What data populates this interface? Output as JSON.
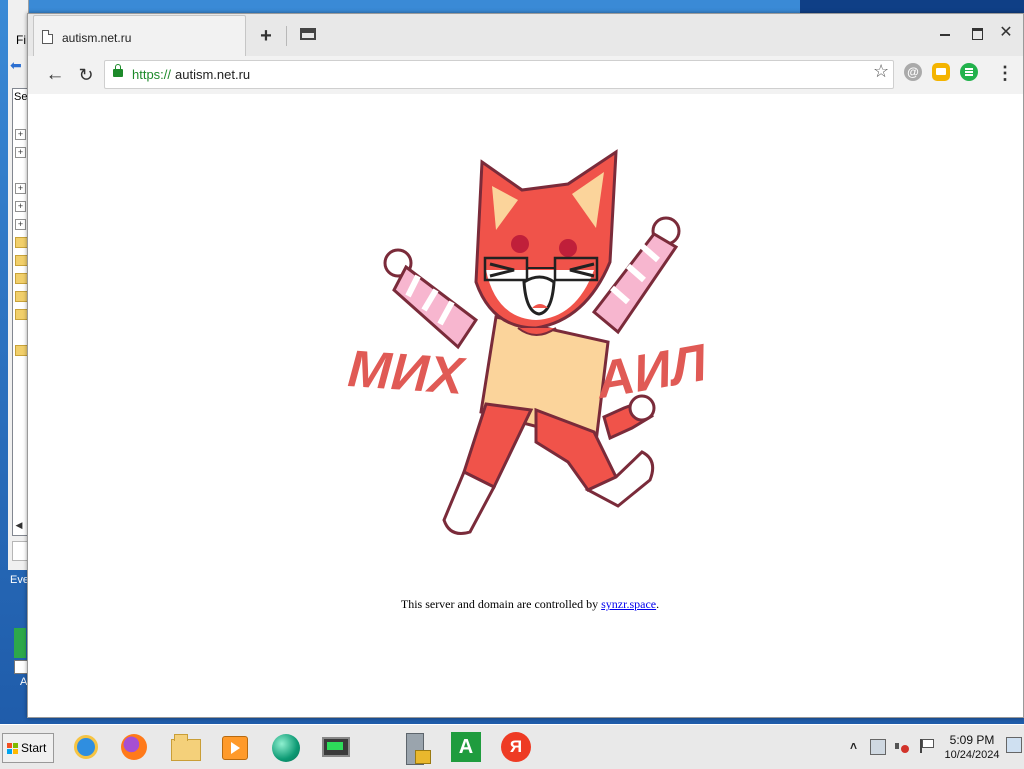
{
  "background_window": {
    "file_menu_label": "Fi",
    "tree_header": "Se",
    "desktop_label": "Eve",
    "desktop_icon_label": "A"
  },
  "browser": {
    "tab": {
      "title": "autism.net.ru"
    },
    "address_bar": {
      "protocol": "https://",
      "host": "autism.net.ru"
    },
    "extensions": [
      "mail-ru-extension",
      "messenger-extension",
      "list-extension"
    ],
    "accent_secure": "#1d8a2a"
  },
  "page": {
    "mascot": {
      "text_left": "МИХ",
      "text_right": "АИЛ"
    },
    "footer": {
      "prefix": "This server and domain are controlled by ",
      "link": "synzr.space",
      "suffix": "."
    }
  },
  "taskbar": {
    "start_label": "Start",
    "pinned": [
      "internet-explorer",
      "firefox",
      "windows-explorer",
      "media-player",
      "globe-app",
      "task-manager",
      "server-manager",
      "app-a",
      "yandex-browser"
    ],
    "app_a_glyph": "A",
    "yandex_glyph": "Я",
    "clock": {
      "time": "5:09 PM",
      "date": "10/24/2024"
    }
  }
}
